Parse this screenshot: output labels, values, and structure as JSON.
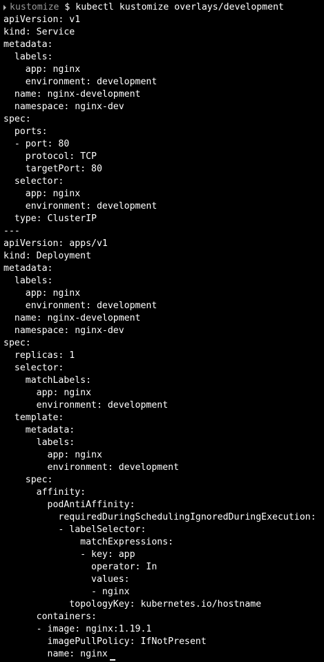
{
  "terminal": {
    "colors": {
      "background": "#000000",
      "foreground": "#ffffff",
      "prompt_dir": "#9a9a9a"
    },
    "prompt": {
      "icon": "prompt-arrow-icon",
      "directory": "kustomize",
      "symbol": " $ ",
      "command": "kubectl kustomize overlays/development"
    },
    "output_lines": [
      "apiVersion: v1",
      "kind: Service",
      "metadata:",
      "  labels:",
      "    app: nginx",
      "    environment: development",
      "  name: nginx-development",
      "  namespace: nginx-dev",
      "spec:",
      "  ports:",
      "  - port: 80",
      "    protocol: TCP",
      "    targetPort: 80",
      "  selector:",
      "    app: nginx",
      "    environment: development",
      "  type: ClusterIP",
      "---",
      "apiVersion: apps/v1",
      "kind: Deployment",
      "metadata:",
      "  labels:",
      "    app: nginx",
      "    environment: development",
      "  name: nginx-development",
      "  namespace: nginx-dev",
      "spec:",
      "  replicas: 1",
      "  selector:",
      "    matchLabels:",
      "      app: nginx",
      "      environment: development",
      "  template:",
      "    metadata:",
      "      labels:",
      "        app: nginx",
      "        environment: development",
      "    spec:",
      "      affinity:",
      "        podAntiAffinity:",
      "          requiredDuringSchedulingIgnoredDuringExecution:",
      "          - labelSelector:",
      "              matchExpressions:",
      "              - key: app",
      "                operator: In",
      "                values:",
      "                - nginx",
      "            topologyKey: kubernetes.io/hostname",
      "      containers:",
      "      - image: nginx:1.19.1",
      "        imagePullPolicy: IfNotPresent",
      "        name: nginx"
    ]
  }
}
